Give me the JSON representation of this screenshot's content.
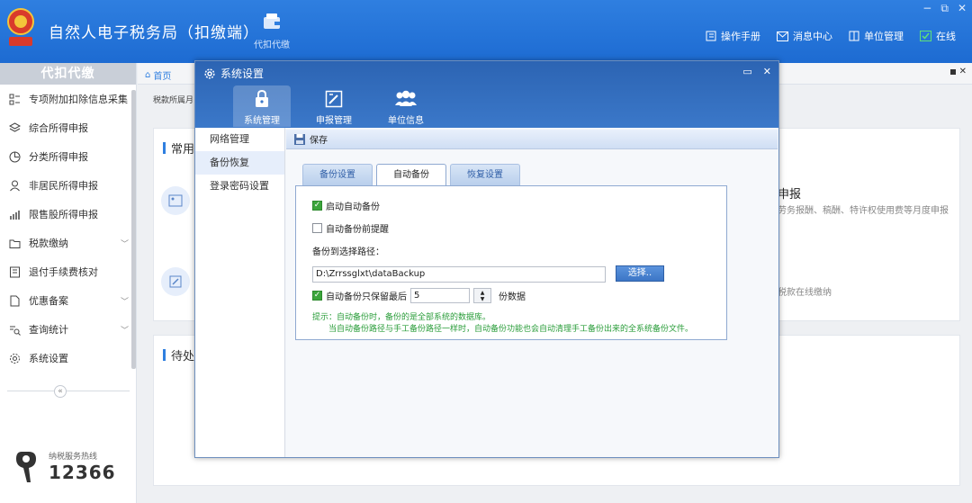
{
  "app": {
    "title": "自然人电子税务局（扣缴端）",
    "top_nav_label": "代扣代缴",
    "actions": [
      {
        "label": "操作手册",
        "icon": "book-icon"
      },
      {
        "label": "消息中心",
        "icon": "mail-icon"
      },
      {
        "label": "单位管理",
        "icon": "building-icon"
      },
      {
        "label": "在线",
        "icon": "online-check-icon"
      }
    ],
    "window_controls": [
      "−",
      "⧉",
      "✕"
    ]
  },
  "sidebar": {
    "header": "代扣代缴",
    "items": [
      {
        "label": "专项附加扣除信息采集",
        "icon": "list-icon",
        "chevron": false
      },
      {
        "label": "综合所得申报",
        "icon": "layers-icon",
        "chevron": false
      },
      {
        "label": "分类所得申报",
        "icon": "pie-icon",
        "chevron": false
      },
      {
        "label": "非居民所得申报",
        "icon": "person-icon",
        "chevron": false
      },
      {
        "label": "限售股所得申报",
        "icon": "bar-chart-icon",
        "chevron": false
      },
      {
        "label": "税款缴纳",
        "icon": "folder-icon",
        "chevron": true
      },
      {
        "label": "退付手续费核对",
        "icon": "receipt-icon",
        "chevron": false
      },
      {
        "label": "优惠备案",
        "icon": "document-icon",
        "chevron": true
      },
      {
        "label": "查询统计",
        "icon": "query-icon",
        "chevron": true
      },
      {
        "label": "系统设置",
        "icon": "gear-icon",
        "chevron": false
      }
    ],
    "hotline_label": "纳税服务热线",
    "hotline_number": "12366"
  },
  "main": {
    "home_tab": "首页",
    "breadcrumb": "税款所属月",
    "common_title": "常用功",
    "pending_title": "待处",
    "right_title": "申报",
    "right_desc": "劳务报酬、稿酬、特许权使用费等月度申报",
    "right_desc2": "税款在线缴纳"
  },
  "dialog": {
    "title": "系统设置",
    "controls": [
      "▭",
      "✕"
    ],
    "tools": [
      {
        "label": "系统管理",
        "icon": "lock-icon",
        "active": true
      },
      {
        "label": "申报管理",
        "icon": "edit-doc-icon",
        "active": false
      },
      {
        "label": "单位信息",
        "icon": "users-icon",
        "active": false
      }
    ],
    "nav": [
      {
        "label": "网络管理",
        "active": false
      },
      {
        "label": "备份恢复",
        "active": true
      },
      {
        "label": "登录密码设置",
        "active": false
      }
    ],
    "save_label": "保存",
    "subtabs": [
      {
        "label": "备份设置",
        "active": false
      },
      {
        "label": "自动备份",
        "active": true
      },
      {
        "label": "恢复设置",
        "active": false
      }
    ],
    "auto_backup": {
      "enable_label": "启动自动备份",
      "enable_checked": true,
      "remind_label": "自动备份前提醒",
      "remind_checked": false,
      "path_label": "备份到选择路径：",
      "path_value": "D:\\Zrrssglxt\\dataBackup",
      "choose_label": "选择..",
      "keep_label": "自动备份只保留最后",
      "keep_checked": true,
      "keep_value": "5",
      "keep_unit": "份数据",
      "hint_line1": "提示：自动备份时，备份的是全部系统的数据库。",
      "hint_line2": "当自动备份路径与手工备份路径一样时，自动备份功能也会自动清理手工备份出来的全系统备份文件。"
    }
  }
}
